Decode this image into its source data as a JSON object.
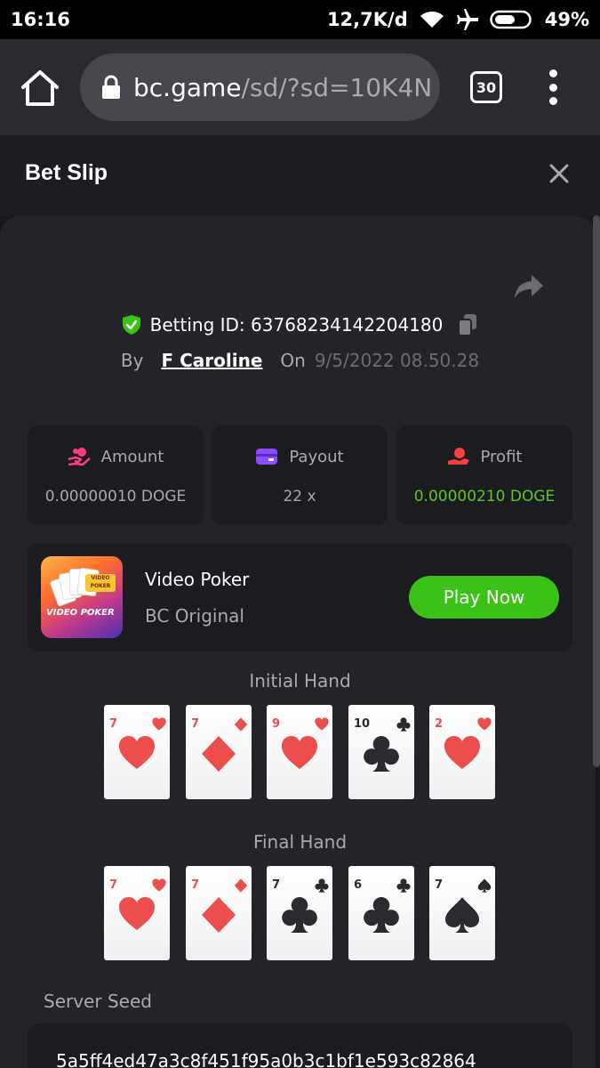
{
  "status_bar": {
    "time": "16:16",
    "speed": "12,7K/d",
    "battery": "49%"
  },
  "browser": {
    "url_host": "bc.game",
    "url_path": "/sd/?sd=10K4N",
    "tab_count": "30"
  },
  "slip": {
    "title": "Bet Slip",
    "betting_id": "Betting ID: 63768234142204180",
    "by_label": "By",
    "user": "F Caroline",
    "on_label": "On",
    "date": "9/5/2022 08.50.28"
  },
  "stats": [
    {
      "label": "Amount",
      "value": "0.00000010 DOGE",
      "icon": "amount-icon",
      "color": "#ff3d7f"
    },
    {
      "label": "Payout",
      "value": "22 x",
      "icon": "wallet-icon",
      "color": "#8b4dff"
    },
    {
      "label": "Profit",
      "value": "0.00000210 DOGE",
      "icon": "profit-icon",
      "color": "#ff3d3d",
      "value_color": "#5fc626"
    }
  ],
  "game": {
    "name": "Video Poker",
    "sub": "BC Original",
    "play_label": "Play Now",
    "thumb_title": "VIDEO POKER",
    "thumb_banner": "VIDEO POKER"
  },
  "hands": {
    "initial_label": "Initial Hand",
    "final_label": "Final Hand",
    "initial": [
      {
        "rank": "7",
        "suit": "heart"
      },
      {
        "rank": "7",
        "suit": "diamond"
      },
      {
        "rank": "9",
        "suit": "heart"
      },
      {
        "rank": "10",
        "suit": "club"
      },
      {
        "rank": "2",
        "suit": "heart"
      }
    ],
    "final": [
      {
        "rank": "7",
        "suit": "heart"
      },
      {
        "rank": "7",
        "suit": "diamond"
      },
      {
        "rank": "7",
        "suit": "club"
      },
      {
        "rank": "6",
        "suit": "club"
      },
      {
        "rank": "7",
        "suit": "spade"
      }
    ]
  },
  "seed": {
    "label": "Server Seed",
    "value": "5a5ff4ed47a3c8f451f95a0b3c1bf1e593c82864"
  },
  "colors": {
    "accent_green": "#3bc117",
    "profit_green": "#5fc626",
    "panel": "#232427",
    "card_red": "#ec4d4d"
  }
}
